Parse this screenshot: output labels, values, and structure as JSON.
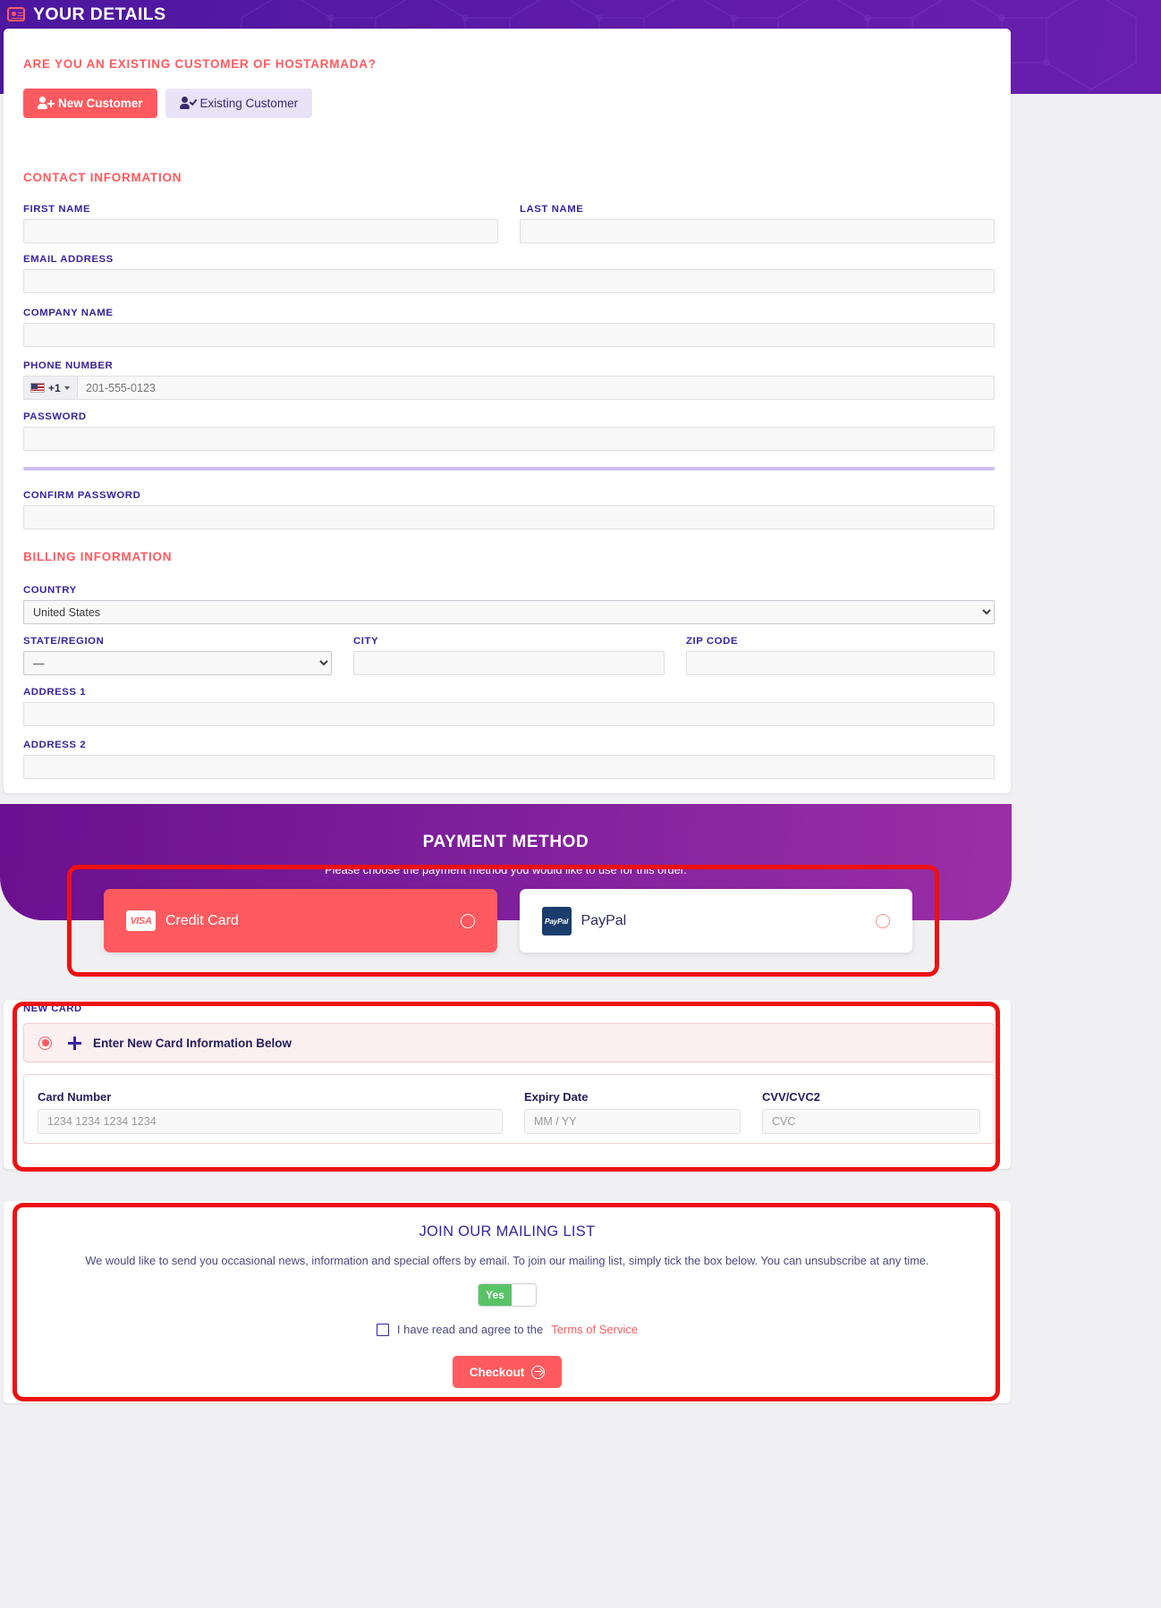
{
  "header": {
    "title": "YOUR DETAILS",
    "icon": "id-card-icon"
  },
  "details": {
    "existing_customer_question": "ARE YOU AN EXISTING CUSTOMER OF HOSTARMADA?",
    "new_customer_label": "New Customer",
    "existing_customer_label": "Existing Customer",
    "contact_section_title": "CONTACT INFORMATION",
    "billing_section_title": "BILLING INFORMATION",
    "fields": {
      "first_name_label": "FIRST NAME",
      "first_name_value": "",
      "last_name_label": "LAST NAME",
      "last_name_value": "",
      "email_label": "EMAIL ADDRESS",
      "email_value": "",
      "company_label": "COMPANY NAME",
      "company_value": "",
      "phone_label": "PHONE NUMBER",
      "phone_country_code": "+1",
      "phone_placeholder": "201-555-0123",
      "phone_value": "",
      "password_label": "PASSWORD",
      "password_value": "",
      "confirm_password_label": "CONFIRM PASSWORD",
      "confirm_password_value": "",
      "country_label": "COUNTRY",
      "country_value": "United States",
      "state_label": "STATE/REGION",
      "state_value": "—",
      "city_label": "CITY",
      "city_value": "",
      "zip_label": "ZIP CODE",
      "zip_value": "",
      "address1_label": "ADDRESS 1",
      "address1_value": "",
      "address2_label": "ADDRESS 2",
      "address2_value": ""
    }
  },
  "payment": {
    "title": "PAYMENT METHOD",
    "subtitle": "Please choose the payment method you would like to use for this order.",
    "options": [
      {
        "label": "Credit Card",
        "badge": "VISA",
        "selected": true
      },
      {
        "label": "PayPal",
        "badge": "PayPal",
        "selected": false
      }
    ]
  },
  "new_card": {
    "section_label": "NEW CARD",
    "enter_new_label": "Enter New Card Information Below",
    "card_number_label": "Card Number",
    "card_number_placeholder": "1234 1234 1234 1234",
    "card_number_value": "",
    "expiry_label": "Expiry Date",
    "expiry_placeholder": "MM / YY",
    "expiry_value": "",
    "cvc_label": "CVV/CVC2",
    "cvc_placeholder": "CVC",
    "cvc_value": ""
  },
  "mailing": {
    "title": "JOIN OUR MAILING LIST",
    "description": "We would like to send you occasional news, information and special offers by email. To join our mailing list, simply tick the box below. You can unsubscribe at any time.",
    "toggle_on_label": "Yes",
    "tos_text": "I have read and agree to the",
    "tos_link": "Terms of Service",
    "checkout_label": "Checkout"
  },
  "colors": {
    "accent_red": "#ff5a5f",
    "brand_purple": "#5d1ba6",
    "banner_purple": "#6a1090",
    "label_purple": "#3a22a0",
    "toggle_green": "#58c466",
    "annotation_red": "#ee1111"
  }
}
